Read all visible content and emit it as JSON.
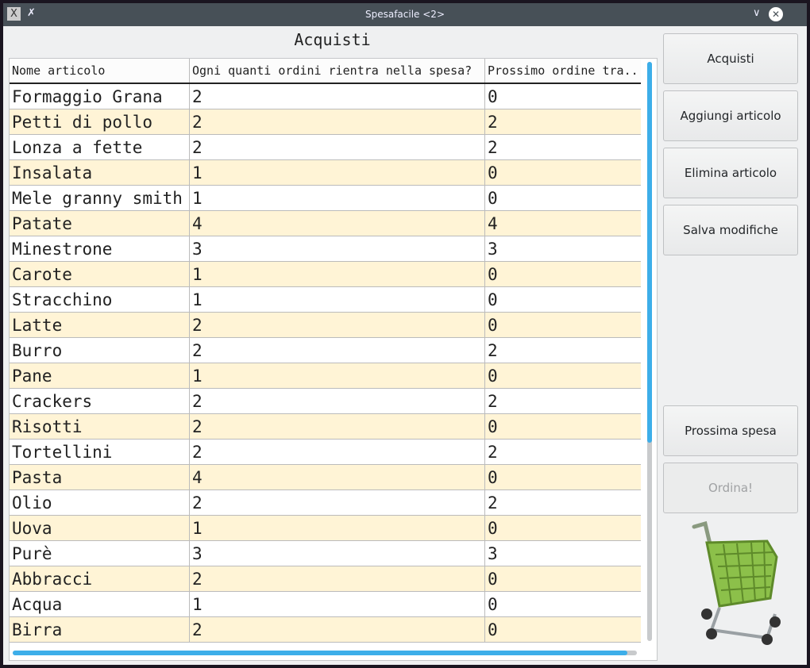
{
  "window": {
    "title": "Spesafacile <2>"
  },
  "heading": "Acquisti",
  "table": {
    "columns": [
      "Nome articolo",
      "Ogni quanti ordini rientra nella spesa?",
      "Prossimo ordine tra.."
    ],
    "rows": [
      [
        "Formaggio Grana",
        "2",
        "0"
      ],
      [
        "Petti di pollo",
        "2",
        "2"
      ],
      [
        "Lonza a fette",
        "2",
        "2"
      ],
      [
        "Insalata",
        "1",
        "0"
      ],
      [
        "Mele granny smith",
        "1",
        "0"
      ],
      [
        "Patate",
        "4",
        "4"
      ],
      [
        "Minestrone",
        "3",
        "3"
      ],
      [
        "Carote",
        "1",
        "0"
      ],
      [
        "Stracchino",
        "1",
        "0"
      ],
      [
        "Latte",
        "2",
        "0"
      ],
      [
        "Burro",
        "2",
        "2"
      ],
      [
        "Pane",
        "1",
        "0"
      ],
      [
        "Crackers",
        "2",
        "2"
      ],
      [
        "Risotti",
        "2",
        "0"
      ],
      [
        "Tortellini",
        "2",
        "2"
      ],
      [
        "Pasta",
        "4",
        "0"
      ],
      [
        "Olio",
        "2",
        "2"
      ],
      [
        "Uova",
        "1",
        "0"
      ],
      [
        "Purè",
        "3",
        "3"
      ],
      [
        "Abbracci",
        "2",
        "0"
      ],
      [
        "Acqua",
        "1",
        "0"
      ],
      [
        "Birra",
        "2",
        "0"
      ]
    ]
  },
  "buttons": {
    "acquisti": "Acquisti",
    "aggiungi": "Aggiungi articolo",
    "elimina": "Elimina articolo",
    "salva": "Salva modifiche",
    "prossima": "Prossima spesa",
    "ordina": "Ordina!"
  },
  "colors": {
    "accent": "#3daee9",
    "alt_row": "#fff4d6",
    "titlebar": "#475057"
  }
}
